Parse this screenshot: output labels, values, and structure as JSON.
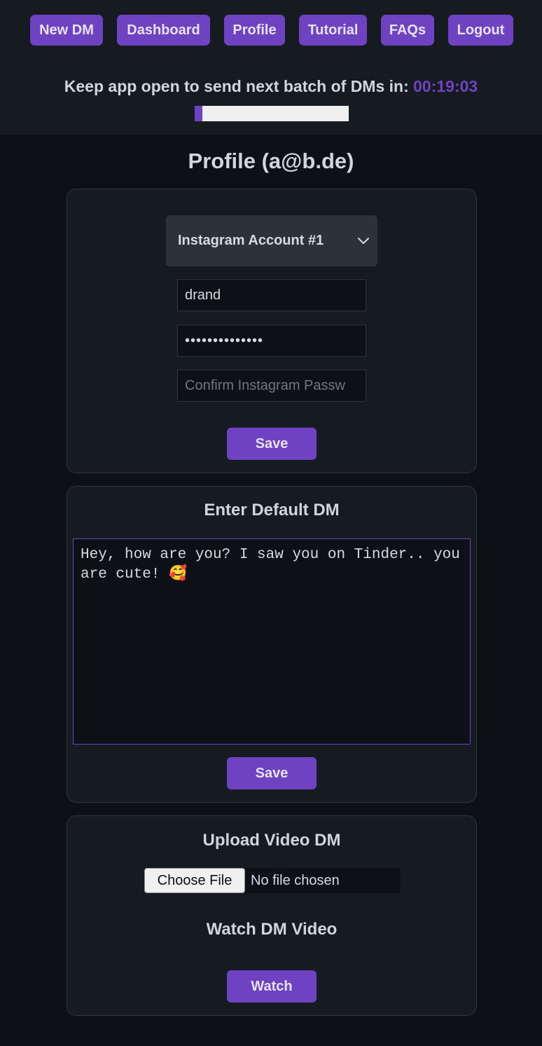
{
  "nav": [
    {
      "label": "New DM"
    },
    {
      "label": "Dashboard"
    },
    {
      "label": "Profile"
    },
    {
      "label": "Tutorial"
    },
    {
      "label": "FAQs"
    },
    {
      "label": "Logout"
    }
  ],
  "timer": {
    "label": "Keep app open to send next batch of DMs in:",
    "value": "00:19:03",
    "progress_fraction": 0.05
  },
  "page_title": "Profile (a@b.de)",
  "account_card": {
    "selected_account": "Instagram Account #1",
    "username_value": "drand",
    "password_value": "••••••••••••••",
    "confirm_placeholder": "Confirm Instagram Passw",
    "save_label": "Save"
  },
  "dm_card": {
    "title": "Enter Default DM",
    "message": "Hey, how are you? I saw you on Tinder.. you are cute! 🥰",
    "save_label": "Save"
  },
  "video_card": {
    "title": "Upload Video DM",
    "choose_file_label": "Choose File",
    "file_status": "No file chosen",
    "watch_title": "Watch DM Video",
    "watch_label": "Watch"
  },
  "colors": {
    "accent": "#6f42c1",
    "background": "#0d1117",
    "panel": "#161b22",
    "border": "#30363d"
  }
}
